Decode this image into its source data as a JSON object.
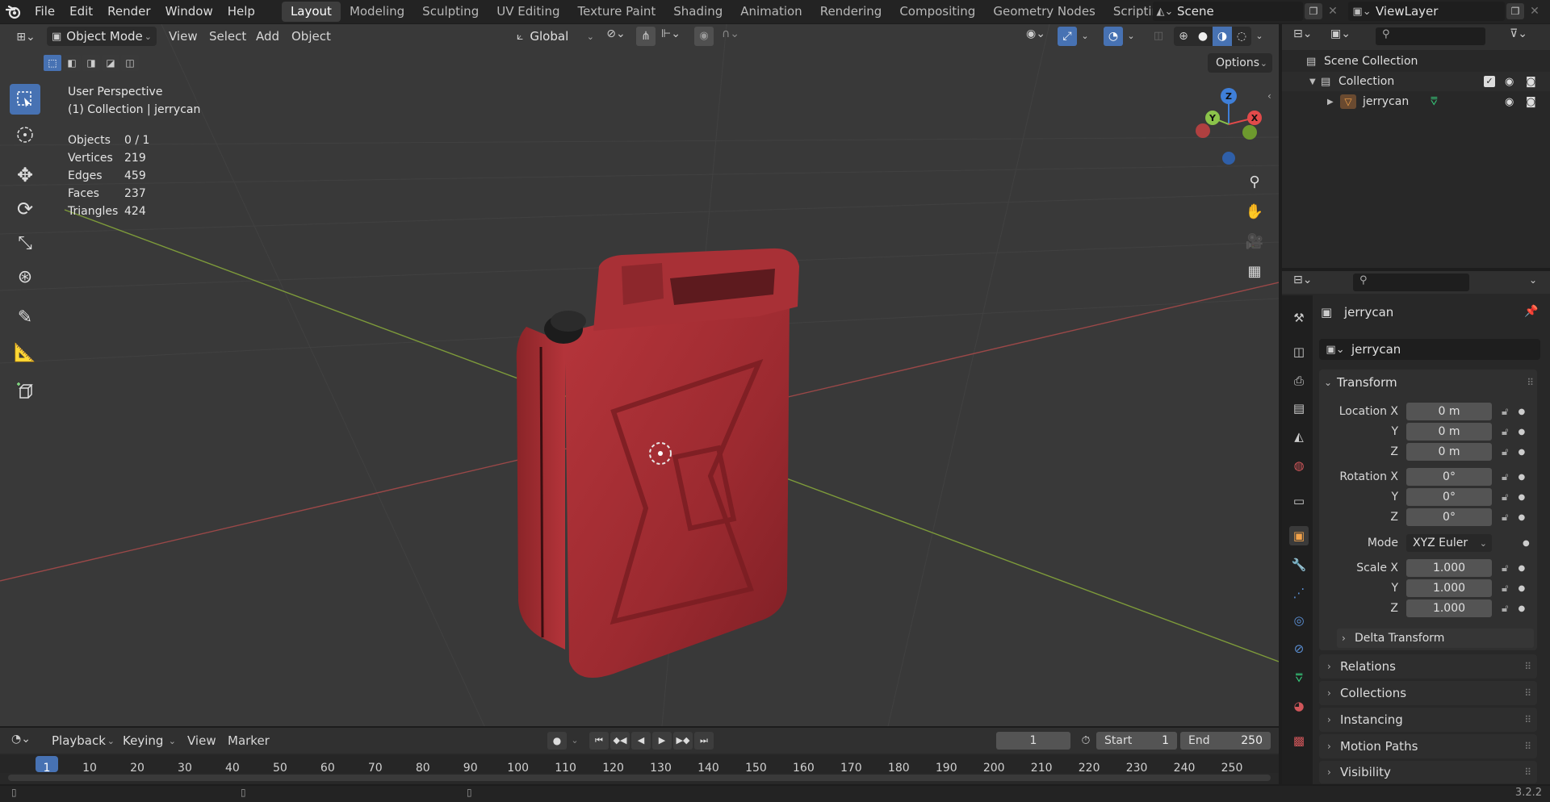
{
  "menus": [
    "File",
    "Edit",
    "Render",
    "Window",
    "Help"
  ],
  "workspaces": [
    "Layout",
    "Modeling",
    "Sculpting",
    "UV Editing",
    "Texture Paint",
    "Shading",
    "Animation",
    "Rendering",
    "Compositing",
    "Geometry Nodes",
    "Scripting"
  ],
  "add_tab": "+",
  "scene": {
    "name": "Scene"
  },
  "view_layer": {
    "name": "ViewLayer"
  },
  "viewport_header": {
    "mode": "Object Mode",
    "view": "View",
    "select": "Select",
    "add": "Add",
    "object": "Object",
    "orientation": "Global",
    "options": "Options"
  },
  "overlay": {
    "perspective": "User Perspective",
    "collection_line": "(1) Collection | jerrycan",
    "stats": [
      {
        "label": "Objects",
        "value": "0 / 1"
      },
      {
        "label": "Vertices",
        "value": "219"
      },
      {
        "label": "Edges",
        "value": "459"
      },
      {
        "label": "Faces",
        "value": "237"
      },
      {
        "label": "Triangles",
        "value": "424"
      }
    ]
  },
  "gizmo": {
    "x": "X",
    "y": "Y",
    "z": "Z"
  },
  "outliner": {
    "scene_collection": "Scene Collection",
    "collection": "Collection",
    "object": "jerrycan"
  },
  "properties": {
    "object_name": "jerrycan",
    "data_name": "jerrycan",
    "transform_label": "Transform",
    "location_label": "Location X",
    "rotation_label": "Rotation X",
    "scale_label": "Scale X",
    "axis_y": "Y",
    "axis_z": "Z",
    "location": [
      "0 m",
      "0 m",
      "0 m"
    ],
    "rotation": [
      "0°",
      "0°",
      "0°"
    ],
    "mode_label": "Mode",
    "mode_value": "XYZ Euler",
    "scale": [
      "1.000",
      "1.000",
      "1.000"
    ],
    "delta_transform": "Delta Transform",
    "panels": [
      "Relations",
      "Collections",
      "Instancing",
      "Motion Paths",
      "Visibility"
    ]
  },
  "timeline": {
    "playback": "Playback",
    "keying": "Keying",
    "view": "View",
    "marker": "Marker",
    "current_frame": "1",
    "start_label": "Start",
    "start_value": "1",
    "end_label": "End",
    "end_value": "250",
    "ruler": [
      "1",
      "10",
      "20",
      "30",
      "40",
      "50",
      "60",
      "70",
      "80",
      "90",
      "100",
      "110",
      "120",
      "130",
      "140",
      "150",
      "160",
      "170",
      "180",
      "190",
      "200",
      "210",
      "220",
      "230",
      "240",
      "250"
    ]
  },
  "version": "3.2.2",
  "colors": {
    "accent": "#4772b3",
    "object_orange": "#f2a24a",
    "x_axis": "#b34a4a",
    "y_axis": "#7f9e3a",
    "gizmo_x": "#e24a4a",
    "gizmo_y": "#8bc34a",
    "gizmo_z": "#3f7fd8"
  }
}
